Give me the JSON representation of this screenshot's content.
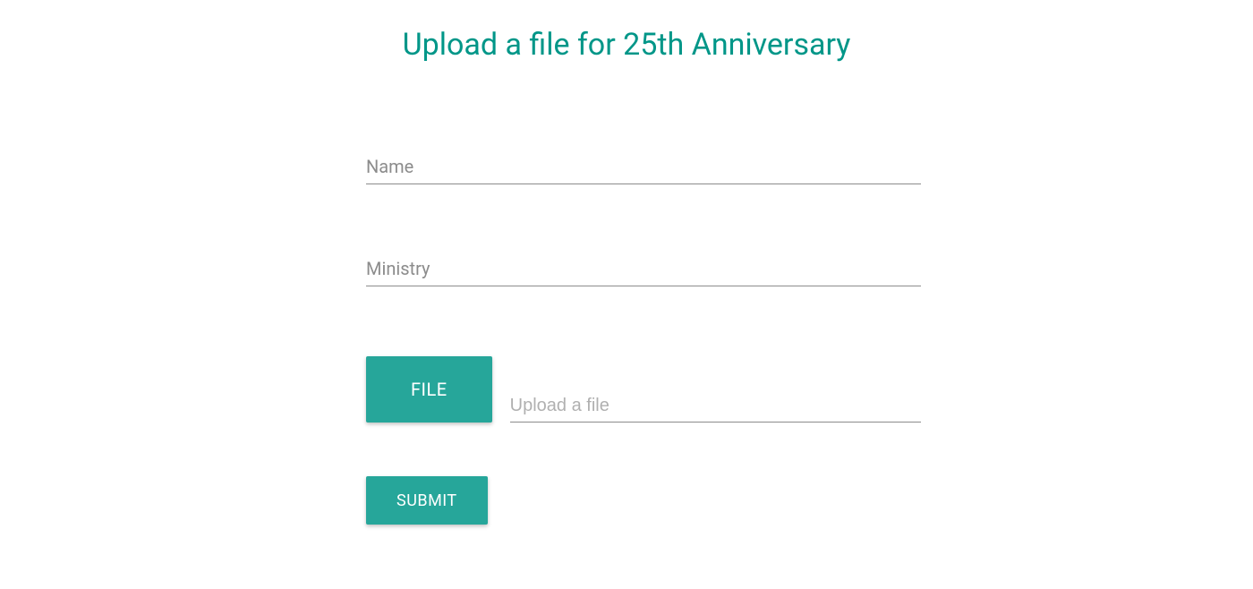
{
  "title": "Upload a file for 25th Anniversary",
  "fields": {
    "name": {
      "label": "Name",
      "value": ""
    },
    "ministry": {
      "label": "Ministry",
      "value": ""
    }
  },
  "file": {
    "button_label": "FILE",
    "placeholder": "Upload a file",
    "value": ""
  },
  "submit_label": "SUBMIT"
}
